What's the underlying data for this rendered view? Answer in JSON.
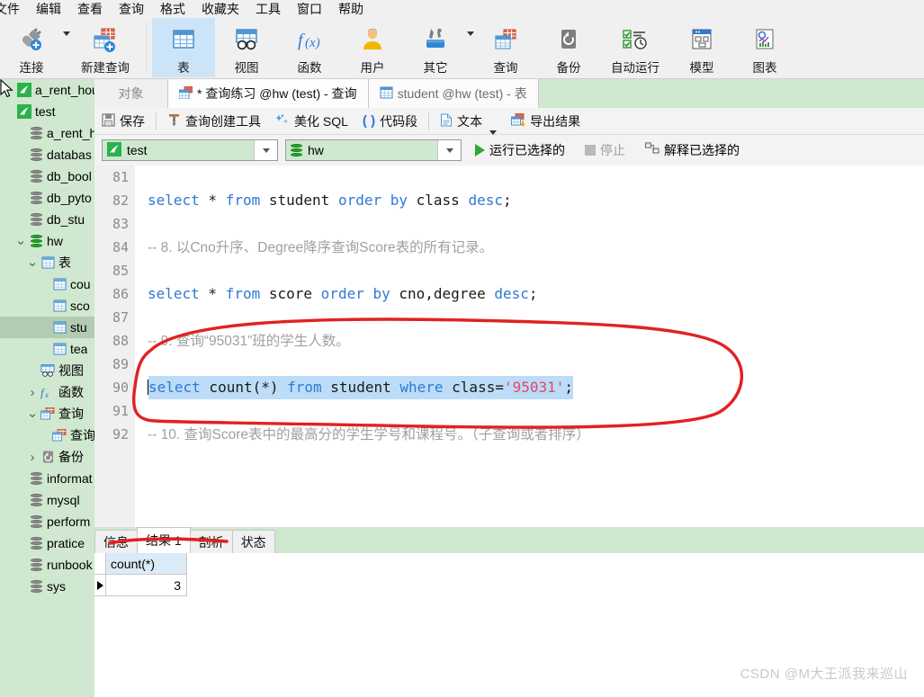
{
  "menubar": {
    "items": [
      "文件",
      "编辑",
      "查看",
      "查询",
      "格式",
      "收藏夹",
      "工具",
      "窗口",
      "帮助"
    ]
  },
  "ribbon": {
    "buttons": [
      {
        "label": "连接",
        "icon": "connect-icon",
        "has_caret": true
      },
      {
        "label": "新建查询",
        "icon": "new-query-icon",
        "has_caret": false
      },
      {
        "label": "表",
        "icon": "table-icon",
        "active": true
      },
      {
        "label": "视图",
        "icon": "view-icon",
        "active": false
      },
      {
        "label": "函数",
        "icon": "function-icon",
        "active": false
      },
      {
        "label": "用户",
        "icon": "user-icon",
        "active": false
      },
      {
        "label": "其它",
        "icon": "other-tools-icon",
        "has_caret": true
      },
      {
        "label": "查询",
        "icon": "query-icon",
        "active": false
      },
      {
        "label": "备份",
        "icon": "backup-icon",
        "active": false
      },
      {
        "label": "自动运行",
        "icon": "automation-icon",
        "active": false
      },
      {
        "label": "模型",
        "icon": "model-icon",
        "active": false
      },
      {
        "label": "图表",
        "icon": "chart-icon",
        "active": false
      }
    ]
  },
  "sidebar": {
    "nodes": [
      {
        "label": "a_rent_hou",
        "icon": "connection-icon",
        "indent": 0,
        "twisty": "",
        "selected": false
      },
      {
        "label": "test",
        "icon": "connection-icon",
        "indent": 0,
        "twisty": "",
        "selected": false
      },
      {
        "label": "a_rent_h",
        "icon": "database-icon",
        "indent": 1,
        "twisty": "",
        "selected": false
      },
      {
        "label": "databas",
        "icon": "database-icon",
        "indent": 1,
        "twisty": "",
        "selected": false
      },
      {
        "label": "db_bool",
        "icon": "database-icon",
        "indent": 1,
        "twisty": "",
        "selected": false
      },
      {
        "label": "db_pyto",
        "icon": "database-icon",
        "indent": 1,
        "twisty": "",
        "selected": false
      },
      {
        "label": "db_stu",
        "icon": "database-icon",
        "indent": 1,
        "twisty": "",
        "selected": false
      },
      {
        "label": "hw",
        "icon": "database-open-icon",
        "indent": 1,
        "twisty": "down",
        "selected": false
      },
      {
        "label": "表",
        "icon": "table-folder-icon",
        "indent": 2,
        "twisty": "down",
        "selected": false
      },
      {
        "label": "cou",
        "icon": "table-icon",
        "indent": 3,
        "twisty": "",
        "selected": false
      },
      {
        "label": "sco",
        "icon": "table-icon",
        "indent": 3,
        "twisty": "",
        "selected": false
      },
      {
        "label": "stu",
        "icon": "table-icon",
        "indent": 3,
        "twisty": "",
        "selected": true
      },
      {
        "label": "tea",
        "icon": "table-icon",
        "indent": 3,
        "twisty": "",
        "selected": false
      },
      {
        "label": "视图",
        "icon": "view-folder-icon",
        "indent": 2,
        "twisty": "",
        "selected": false
      },
      {
        "label": "函数",
        "icon": "function-folder-icon",
        "indent": 2,
        "twisty": "right",
        "selected": false
      },
      {
        "label": "查询",
        "icon": "query-folder-icon",
        "indent": 2,
        "twisty": "down",
        "selected": false
      },
      {
        "label": "查询",
        "icon": "query-icon",
        "indent": 3,
        "twisty": "",
        "selected": false
      },
      {
        "label": "备份",
        "icon": "backup-folder-icon",
        "indent": 2,
        "twisty": "right",
        "selected": false
      },
      {
        "label": "informat",
        "icon": "database-icon",
        "indent": 1,
        "twisty": "",
        "selected": false
      },
      {
        "label": "mysql",
        "icon": "database-icon",
        "indent": 1,
        "twisty": "",
        "selected": false
      },
      {
        "label": "perform",
        "icon": "database-icon",
        "indent": 1,
        "twisty": "",
        "selected": false
      },
      {
        "label": "pratice",
        "icon": "database-icon",
        "indent": 1,
        "twisty": "",
        "selected": false
      },
      {
        "label": "runbook",
        "icon": "database-icon",
        "indent": 1,
        "twisty": "",
        "selected": false
      },
      {
        "label": "sys",
        "icon": "database-icon",
        "indent": 1,
        "twisty": "",
        "selected": false
      }
    ]
  },
  "tabs": {
    "object_label": "对象",
    "editor_tabs": [
      {
        "label": "* 查询练习 @hw (test) - 查询",
        "icon": "query-icon",
        "active": true
      },
      {
        "label": "student @hw (test) - 表",
        "icon": "table-icon",
        "active": false
      }
    ]
  },
  "query_toolbar": {
    "items": [
      {
        "label": "保存",
        "icon": "save-icon"
      },
      {
        "label": "查询创建工具",
        "icon": "query-builder-icon"
      },
      {
        "label": "美化 SQL",
        "icon": "beautify-icon"
      },
      {
        "label": "代码段",
        "icon": "snippet-icon"
      },
      {
        "label": "文本",
        "icon": "text-icon",
        "has_caret": true
      },
      {
        "label": "导出结果",
        "icon": "export-icon"
      }
    ]
  },
  "connection_bar": {
    "connection": "test",
    "database": "hw",
    "run_selected": "运行已选择的",
    "stop": "停止",
    "explain_selected": "解释已选择的"
  },
  "editor": {
    "lines": [
      {
        "no": "81",
        "segments": []
      },
      {
        "no": "82",
        "segments": [
          {
            "t": "select",
            "c": "kw"
          },
          {
            "t": " * ",
            "c": ""
          },
          {
            "t": "from",
            "c": "kw"
          },
          {
            "t": " student ",
            "c": ""
          },
          {
            "t": "order",
            "c": "kw"
          },
          {
            "t": " ",
            "c": ""
          },
          {
            "t": "by",
            "c": "kw"
          },
          {
            "t": " class ",
            "c": ""
          },
          {
            "t": "desc",
            "c": "kw"
          },
          {
            "t": ";",
            "c": ""
          }
        ]
      },
      {
        "no": "83",
        "segments": []
      },
      {
        "no": "84",
        "segments": [
          {
            "t": "-- 8. 以Cno升序、Degree降序查询Score表的所有记录。",
            "c": "cm"
          }
        ]
      },
      {
        "no": "85",
        "segments": []
      },
      {
        "no": "86",
        "segments": [
          {
            "t": "select",
            "c": "kw"
          },
          {
            "t": " * ",
            "c": ""
          },
          {
            "t": "from",
            "c": "kw"
          },
          {
            "t": " score ",
            "c": ""
          },
          {
            "t": "order",
            "c": "kw"
          },
          {
            "t": " ",
            "c": ""
          },
          {
            "t": "by",
            "c": "kw"
          },
          {
            "t": " cno,degree ",
            "c": ""
          },
          {
            "t": "desc",
            "c": "kw"
          },
          {
            "t": ";",
            "c": ""
          }
        ]
      },
      {
        "no": "87",
        "segments": []
      },
      {
        "no": "88",
        "segments": [
          {
            "t": "-- 9. 查询“95031”班的学生人数。",
            "c": "cm"
          }
        ]
      },
      {
        "no": "89",
        "segments": []
      },
      {
        "no": "90",
        "selected": true,
        "segments": [
          {
            "t": "select",
            "c": "kw"
          },
          {
            "t": " count(*) ",
            "c": ""
          },
          {
            "t": "from",
            "c": "kw"
          },
          {
            "t": " student ",
            "c": ""
          },
          {
            "t": "where",
            "c": "kw"
          },
          {
            "t": " class=",
            "c": ""
          },
          {
            "t": "'95031'",
            "c": "str"
          },
          {
            "t": ";",
            "c": ""
          }
        ]
      },
      {
        "no": "91",
        "segments": []
      },
      {
        "no": "92",
        "segments": [
          {
            "t": "-- 10. 查询Score表中的最高分的学生学号和课程号。（子查询或者排序）",
            "c": "cm"
          }
        ]
      }
    ]
  },
  "results": {
    "tabs": [
      {
        "label": "信息",
        "selected": false
      },
      {
        "label": "结果 1",
        "selected": true
      },
      {
        "label": "剖析",
        "selected": false
      },
      {
        "label": "状态",
        "selected": false
      }
    ],
    "columns": [
      "count(*)"
    ],
    "rows": [
      [
        "3"
      ]
    ]
  },
  "watermark": "CSDN @M大王派我来巡山",
  "colors": {
    "tree_bg": "#cfe8cf",
    "accent_blue": "#2f78d6",
    "selection": "#bcdcf7",
    "annotation_red": "#e12121",
    "ribbon_active": "#cce4f7"
  }
}
